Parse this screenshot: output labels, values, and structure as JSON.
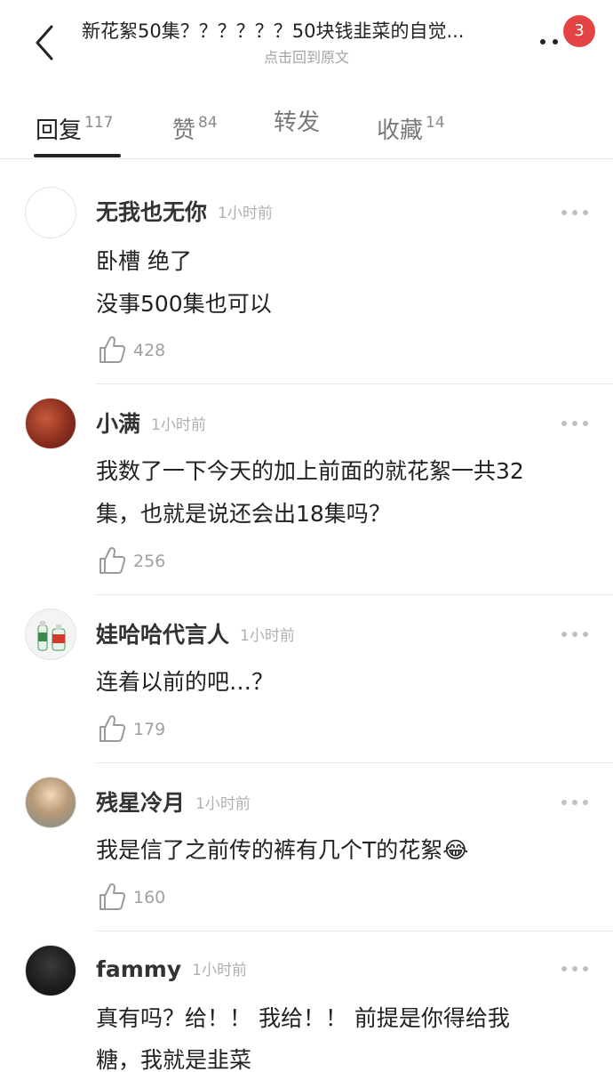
{
  "header": {
    "title": "新花絮50集？？？？？？50块钱韭菜的自觉...",
    "subtitle": "点击回到原文",
    "badge": "3"
  },
  "tabs": [
    {
      "label": "回复",
      "count": "117"
    },
    {
      "label": "赞",
      "count": "84"
    },
    {
      "label": "转发",
      "count": ""
    },
    {
      "label": "收藏",
      "count": "14"
    }
  ],
  "comments": [
    {
      "name": "无我也无你",
      "time": "1小时前",
      "lines": [
        "卧槽 绝了",
        "没事500集也可以"
      ],
      "likes": "428"
    },
    {
      "name": "小满",
      "time": "1小时前",
      "lines": [
        "我数了一下今天的加上前面的就花絮一共32",
        "集，也就是说还会出18集吗？"
      ],
      "likes": "256"
    },
    {
      "name": "娃哈哈代言人",
      "time": "1小时前",
      "lines": [
        "连着以前的吧…？"
      ],
      "likes": "179"
    },
    {
      "name": "残星冷月",
      "time": "1小时前",
      "lines": [
        "我是信了之前传的裤有几个T的花絮😂"
      ],
      "likes": "160"
    },
    {
      "name": "fammy",
      "time": "1小时前",
      "lines": [
        "真有吗？给！！ 我给！！ 前提是你得给我",
        "糖，我就是韭菜"
      ],
      "likes": ""
    }
  ],
  "icons": {
    "back": "back-arrow-icon",
    "more": "more-dots-icon",
    "like": "thumbs-up-icon"
  },
  "colors": {
    "badge": "#e44343",
    "active_tab": "#222222",
    "muted": "#a3a3a3"
  }
}
